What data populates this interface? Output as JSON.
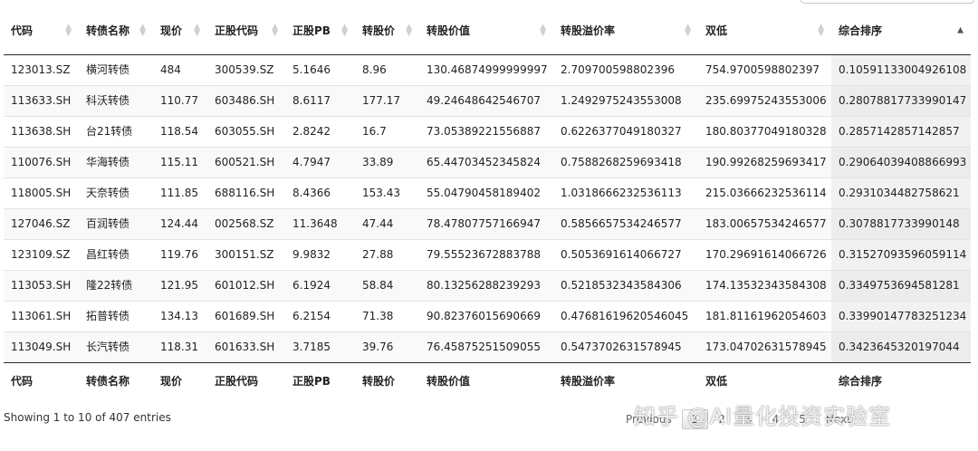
{
  "table": {
    "headers": [
      {
        "label": "代码",
        "sort": "none"
      },
      {
        "label": "转债名称",
        "sort": "none"
      },
      {
        "label": "现价",
        "sort": "none"
      },
      {
        "label": "正股代码",
        "sort": "none"
      },
      {
        "label": "正股PB",
        "sort": "none"
      },
      {
        "label": "转股价",
        "sort": "none"
      },
      {
        "label": "转股价值",
        "sort": "none"
      },
      {
        "label": "转股溢价率",
        "sort": "none"
      },
      {
        "label": "双低",
        "sort": "none"
      },
      {
        "label": "综合排序",
        "sort": "asc"
      }
    ],
    "rows": [
      [
        "123013.SZ",
        "横河转债",
        "484",
        "300539.SZ",
        "5.1646",
        "8.96",
        "130.46874999999997",
        "2.709700598802396",
        "754.9700598802397",
        "0.10591133004926108"
      ],
      [
        "113633.SH",
        "科沃转债",
        "110.77",
        "603486.SH",
        "8.6117",
        "177.17",
        "49.24648642546707",
        "1.2492975243553008",
        "235.69975243553006",
        "0.28078817733990147"
      ],
      [
        "113638.SH",
        "台21转债",
        "118.54",
        "603055.SH",
        "2.8242",
        "16.7",
        "73.05389221556887",
        "0.6226377049180327",
        "180.80377049180328",
        "0.2857142857142857"
      ],
      [
        "110076.SH",
        "华海转债",
        "115.11",
        "600521.SH",
        "4.7947",
        "33.89",
        "65.44703452345824",
        "0.7588268259693418",
        "190.99268259693417",
        "0.29064039408866993"
      ],
      [
        "118005.SH",
        "天奈转债",
        "111.85",
        "688116.SH",
        "8.4366",
        "153.43",
        "55.04790458189402",
        "1.0318666232536113",
        "215.03666232536114",
        "0.2931034482758621"
      ],
      [
        "127046.SZ",
        "百润转债",
        "124.44",
        "002568.SZ",
        "11.3648",
        "47.44",
        "78.47807757166947",
        "0.5856657534246577",
        "183.00657534246577",
        "0.3078817733990148"
      ],
      [
        "123109.SZ",
        "昌红转债",
        "119.76",
        "300151.SZ",
        "9.9832",
        "27.88",
        "79.55523672883788",
        "0.5053691614066727",
        "170.29691614066726",
        "0.31527093596059114"
      ],
      [
        "113053.SH",
        "隆22转债",
        "121.95",
        "601012.SH",
        "6.1924",
        "58.84",
        "80.13256288239293",
        "0.5218532343584306",
        "174.13532343584308",
        "0.3349753694581281"
      ],
      [
        "113061.SH",
        "拓普转债",
        "134.13",
        "601689.SH",
        "6.2154",
        "71.38",
        "90.82376015690669",
        "0.47681619620546045",
        "181.81161962054603",
        "0.33990147783251234"
      ],
      [
        "113049.SH",
        "长汽转债",
        "118.31",
        "601633.SH",
        "3.7185",
        "39.76",
        "76.45875251509055",
        "0.5473702631578945",
        "173.04702631578945",
        "0.3423645320197044"
      ]
    ],
    "footer": [
      "代码",
      "转债名称",
      "现价",
      "正股代码",
      "正股PB",
      "转股价",
      "转股价值",
      "转股溢价率",
      "双低",
      "综合排序"
    ]
  },
  "info": "Showing 1 to 10 of 407 entries",
  "pagination": {
    "previous": "Previous",
    "pages": [
      "1",
      "2",
      "3",
      "4",
      "5"
    ],
    "current": "1",
    "next": "Next"
  },
  "watermark": "知乎 @AI量化投资实验室",
  "colors": {
    "header_rule": "#2a2a2a",
    "stripe": "#f9f9f9",
    "sorted_col": "#f1f1f1"
  }
}
